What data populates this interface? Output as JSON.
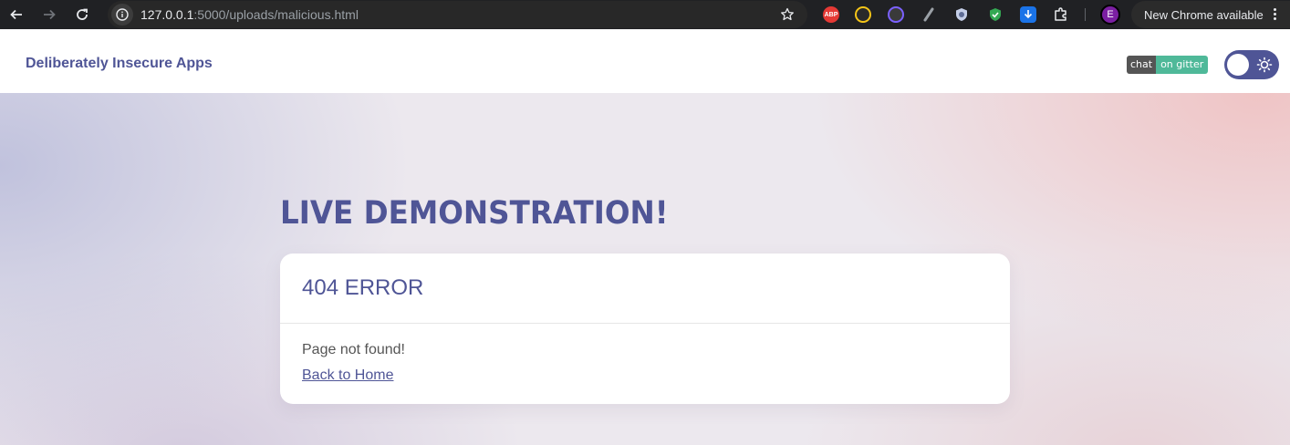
{
  "browser": {
    "url_host": "127.0.0.1",
    "url_rest": ":5000/uploads/malicious.html",
    "extensions": [
      {
        "name": "adblock-plus-icon",
        "label": "ABP",
        "color": "#e53935"
      },
      {
        "name": "coin-extension-icon",
        "label": "",
        "color": "#f5c518"
      },
      {
        "name": "vk-extension-icon",
        "label": "",
        "color": "#3a3a3a"
      },
      {
        "name": "feather-extension-icon",
        "label": "",
        "color": "#5f6368"
      },
      {
        "name": "shield-extension-icon",
        "label": "",
        "color": "#8ab4f8"
      },
      {
        "name": "green-shield-extension-icon",
        "label": "",
        "color": "#34a853"
      },
      {
        "name": "download-extension-icon",
        "label": "",
        "color": "#1a73e8"
      }
    ],
    "profile_initial": "E",
    "update_label": "New Chrome available"
  },
  "header": {
    "brand": "Deliberately Insecure Apps",
    "badge_left": "chat",
    "badge_right": "on gitter"
  },
  "main": {
    "title": "LIVE DEMONSTRATION!",
    "card_title": "404 ERROR",
    "message": "Page not found!",
    "back_link": "Back to Home"
  },
  "colors": {
    "accent": "#4f5596",
    "gitter_green": "#4fb999"
  }
}
